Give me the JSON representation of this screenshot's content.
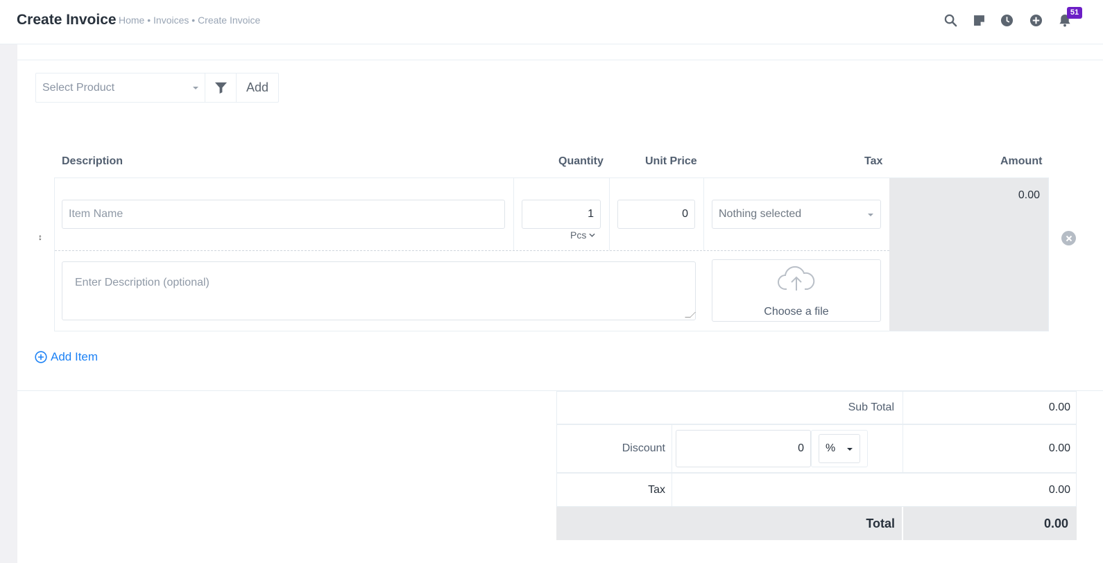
{
  "header": {
    "title": "Create Invoice",
    "breadcrumb": "Home • Invoices • Create Invoice",
    "notification_count": "51"
  },
  "product_picker": {
    "placeholder": "Select Product",
    "add_label": "Add"
  },
  "item_table": {
    "columns": {
      "description": "Description",
      "quantity": "Quantity",
      "unit_price": "Unit Price",
      "tax": "Tax",
      "amount": "Amount"
    },
    "row": {
      "item_name_placeholder": "Item Name",
      "quantity": "1",
      "unit": "Pcs",
      "unit_price": "0",
      "tax_placeholder": "Nothing selected",
      "description_placeholder": "Enter Description (optional)",
      "file_label": "Choose a file",
      "amount": "0.00"
    },
    "add_item_label": "Add Item"
  },
  "summary": {
    "subtotal_label": "Sub Total",
    "subtotal_value": "0.00",
    "discount_label": "Discount",
    "discount_input": "0",
    "discount_type": "%",
    "discount_value": "0.00",
    "tax_label": "Tax",
    "tax_value": "0.00",
    "total_label": "Total",
    "total_value": "0.00"
  }
}
